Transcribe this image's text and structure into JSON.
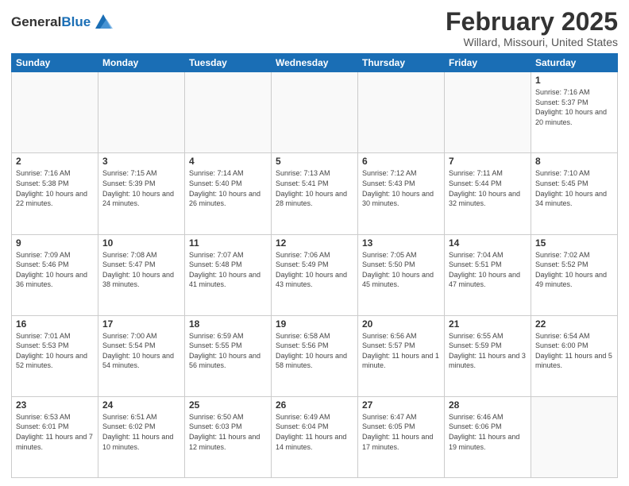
{
  "header": {
    "logo_general": "General",
    "logo_blue": "Blue",
    "title": "February 2025",
    "subtitle": "Willard, Missouri, United States"
  },
  "weekdays": [
    "Sunday",
    "Monday",
    "Tuesday",
    "Wednesday",
    "Thursday",
    "Friday",
    "Saturday"
  ],
  "weeks": [
    [
      {
        "day": "",
        "sunrise": "",
        "sunset": "",
        "daylight": ""
      },
      {
        "day": "",
        "sunrise": "",
        "sunset": "",
        "daylight": ""
      },
      {
        "day": "",
        "sunrise": "",
        "sunset": "",
        "daylight": ""
      },
      {
        "day": "",
        "sunrise": "",
        "sunset": "",
        "daylight": ""
      },
      {
        "day": "",
        "sunrise": "",
        "sunset": "",
        "daylight": ""
      },
      {
        "day": "",
        "sunrise": "",
        "sunset": "",
        "daylight": ""
      },
      {
        "day": "1",
        "sunrise": "Sunrise: 7:16 AM",
        "sunset": "Sunset: 5:37 PM",
        "daylight": "Daylight: 10 hours and 20 minutes."
      }
    ],
    [
      {
        "day": "2",
        "sunrise": "Sunrise: 7:16 AM",
        "sunset": "Sunset: 5:38 PM",
        "daylight": "Daylight: 10 hours and 22 minutes."
      },
      {
        "day": "3",
        "sunrise": "Sunrise: 7:15 AM",
        "sunset": "Sunset: 5:39 PM",
        "daylight": "Daylight: 10 hours and 24 minutes."
      },
      {
        "day": "4",
        "sunrise": "Sunrise: 7:14 AM",
        "sunset": "Sunset: 5:40 PM",
        "daylight": "Daylight: 10 hours and 26 minutes."
      },
      {
        "day": "5",
        "sunrise": "Sunrise: 7:13 AM",
        "sunset": "Sunset: 5:41 PM",
        "daylight": "Daylight: 10 hours and 28 minutes."
      },
      {
        "day": "6",
        "sunrise": "Sunrise: 7:12 AM",
        "sunset": "Sunset: 5:43 PM",
        "daylight": "Daylight: 10 hours and 30 minutes."
      },
      {
        "day": "7",
        "sunrise": "Sunrise: 7:11 AM",
        "sunset": "Sunset: 5:44 PM",
        "daylight": "Daylight: 10 hours and 32 minutes."
      },
      {
        "day": "8",
        "sunrise": "Sunrise: 7:10 AM",
        "sunset": "Sunset: 5:45 PM",
        "daylight": "Daylight: 10 hours and 34 minutes."
      }
    ],
    [
      {
        "day": "9",
        "sunrise": "Sunrise: 7:09 AM",
        "sunset": "Sunset: 5:46 PM",
        "daylight": "Daylight: 10 hours and 36 minutes."
      },
      {
        "day": "10",
        "sunrise": "Sunrise: 7:08 AM",
        "sunset": "Sunset: 5:47 PM",
        "daylight": "Daylight: 10 hours and 38 minutes."
      },
      {
        "day": "11",
        "sunrise": "Sunrise: 7:07 AM",
        "sunset": "Sunset: 5:48 PM",
        "daylight": "Daylight: 10 hours and 41 minutes."
      },
      {
        "day": "12",
        "sunrise": "Sunrise: 7:06 AM",
        "sunset": "Sunset: 5:49 PM",
        "daylight": "Daylight: 10 hours and 43 minutes."
      },
      {
        "day": "13",
        "sunrise": "Sunrise: 7:05 AM",
        "sunset": "Sunset: 5:50 PM",
        "daylight": "Daylight: 10 hours and 45 minutes."
      },
      {
        "day": "14",
        "sunrise": "Sunrise: 7:04 AM",
        "sunset": "Sunset: 5:51 PM",
        "daylight": "Daylight: 10 hours and 47 minutes."
      },
      {
        "day": "15",
        "sunrise": "Sunrise: 7:02 AM",
        "sunset": "Sunset: 5:52 PM",
        "daylight": "Daylight: 10 hours and 49 minutes."
      }
    ],
    [
      {
        "day": "16",
        "sunrise": "Sunrise: 7:01 AM",
        "sunset": "Sunset: 5:53 PM",
        "daylight": "Daylight: 10 hours and 52 minutes."
      },
      {
        "day": "17",
        "sunrise": "Sunrise: 7:00 AM",
        "sunset": "Sunset: 5:54 PM",
        "daylight": "Daylight: 10 hours and 54 minutes."
      },
      {
        "day": "18",
        "sunrise": "Sunrise: 6:59 AM",
        "sunset": "Sunset: 5:55 PM",
        "daylight": "Daylight: 10 hours and 56 minutes."
      },
      {
        "day": "19",
        "sunrise": "Sunrise: 6:58 AM",
        "sunset": "Sunset: 5:56 PM",
        "daylight": "Daylight: 10 hours and 58 minutes."
      },
      {
        "day": "20",
        "sunrise": "Sunrise: 6:56 AM",
        "sunset": "Sunset: 5:57 PM",
        "daylight": "Daylight: 11 hours and 1 minute."
      },
      {
        "day": "21",
        "sunrise": "Sunrise: 6:55 AM",
        "sunset": "Sunset: 5:59 PM",
        "daylight": "Daylight: 11 hours and 3 minutes."
      },
      {
        "day": "22",
        "sunrise": "Sunrise: 6:54 AM",
        "sunset": "Sunset: 6:00 PM",
        "daylight": "Daylight: 11 hours and 5 minutes."
      }
    ],
    [
      {
        "day": "23",
        "sunrise": "Sunrise: 6:53 AM",
        "sunset": "Sunset: 6:01 PM",
        "daylight": "Daylight: 11 hours and 7 minutes."
      },
      {
        "day": "24",
        "sunrise": "Sunrise: 6:51 AM",
        "sunset": "Sunset: 6:02 PM",
        "daylight": "Daylight: 11 hours and 10 minutes."
      },
      {
        "day": "25",
        "sunrise": "Sunrise: 6:50 AM",
        "sunset": "Sunset: 6:03 PM",
        "daylight": "Daylight: 11 hours and 12 minutes."
      },
      {
        "day": "26",
        "sunrise": "Sunrise: 6:49 AM",
        "sunset": "Sunset: 6:04 PM",
        "daylight": "Daylight: 11 hours and 14 minutes."
      },
      {
        "day": "27",
        "sunrise": "Sunrise: 6:47 AM",
        "sunset": "Sunset: 6:05 PM",
        "daylight": "Daylight: 11 hours and 17 minutes."
      },
      {
        "day": "28",
        "sunrise": "Sunrise: 6:46 AM",
        "sunset": "Sunset: 6:06 PM",
        "daylight": "Daylight: 11 hours and 19 minutes."
      },
      {
        "day": "",
        "sunrise": "",
        "sunset": "",
        "daylight": ""
      }
    ]
  ]
}
